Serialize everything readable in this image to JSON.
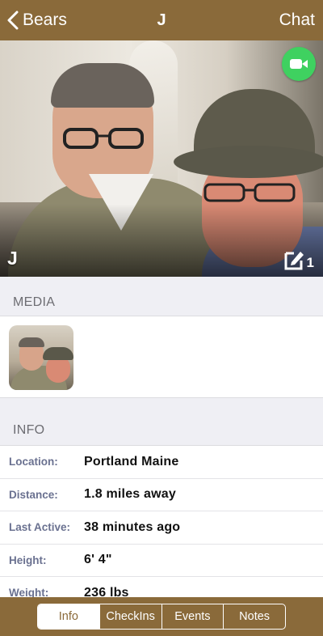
{
  "navbar": {
    "back_label": "Bears",
    "title": "J",
    "chat_label": "Chat"
  },
  "profile": {
    "name": "J",
    "notes_count": "1"
  },
  "media": {
    "header": "MEDIA"
  },
  "info": {
    "header": "INFO",
    "rows": [
      {
        "label": "Location:",
        "value": "Portland Maine"
      },
      {
        "label": "Distance:",
        "value": "1.8 miles away"
      },
      {
        "label": "Last Active:",
        "value": "38 minutes ago"
      },
      {
        "label": "Height:",
        "value": "6' 4\""
      },
      {
        "label": "Weight:",
        "value": "236 lbs"
      }
    ]
  },
  "tabs": {
    "items": [
      "Info",
      "CheckIns",
      "Events",
      "Notes"
    ],
    "active": "Info"
  },
  "colors": {
    "brand": "#8a6a3a",
    "video_call": "#3fd160"
  }
}
